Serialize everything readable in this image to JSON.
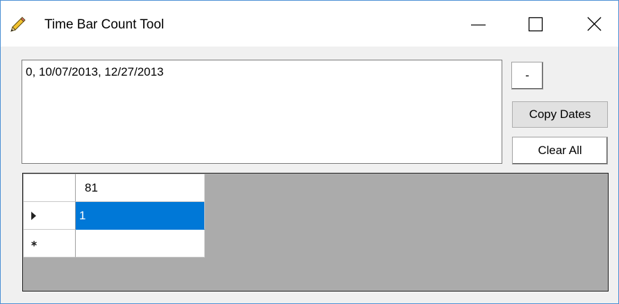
{
  "window": {
    "title": "Time Bar Count Tool",
    "icon": "pencil-icon",
    "accent_color": "#4a8fd4"
  },
  "caption_buttons": {
    "minimize_icon": "minimize-icon",
    "maximize_icon": "maximize-icon",
    "close_icon": "close-icon"
  },
  "textbox": {
    "value": "0, 10/07/2013, 12/27/2013"
  },
  "buttons": {
    "minus_label": "-",
    "copy_dates_label": "Copy Dates",
    "clear_all_label": "Clear All"
  },
  "grid": {
    "column_header": "81",
    "rows": [
      {
        "marker": "current-row-arrow-icon",
        "value": "1",
        "selected": true,
        "selection_color": "#0078d7"
      },
      {
        "marker": "new-row-asterisk-icon",
        "value": "",
        "selected": false
      }
    ]
  }
}
